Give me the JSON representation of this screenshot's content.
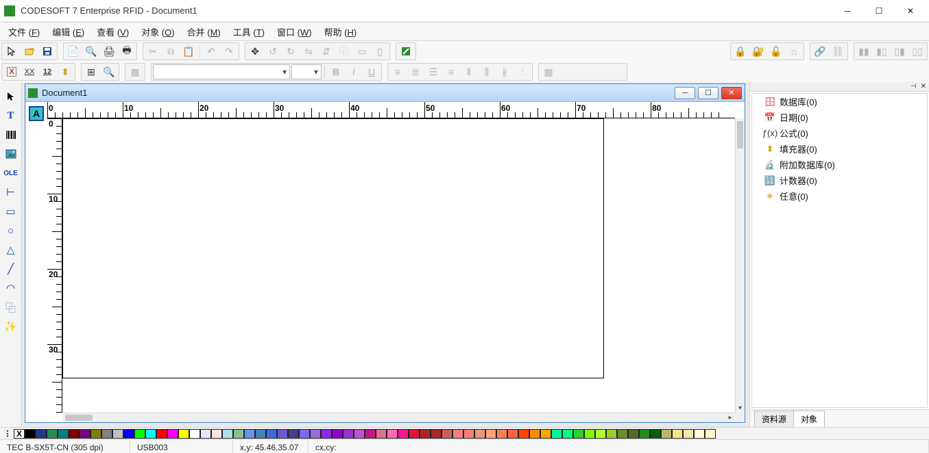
{
  "app": {
    "title": "CODESOFT 7 Enterprise RFID - Document1"
  },
  "menubar": [
    {
      "label": "文件",
      "accel": "F"
    },
    {
      "label": "编辑",
      "accel": "E"
    },
    {
      "label": "查看",
      "accel": "V"
    },
    {
      "label": "对象",
      "accel": "O"
    },
    {
      "label": "合并",
      "accel": "M"
    },
    {
      "label": "工具",
      "accel": "T"
    },
    {
      "label": "窗口",
      "accel": "W"
    },
    {
      "label": "帮助",
      "accel": "H"
    }
  ],
  "document": {
    "title": "Document1"
  },
  "ruler": {
    "h_labels": [
      "0",
      "10",
      "20",
      "30",
      "40",
      "50",
      "60",
      "70",
      "80"
    ],
    "v_labels": [
      "0",
      "10",
      "20",
      "30"
    ]
  },
  "datasources": [
    {
      "icon": "database-icon",
      "label": "数据库(0)",
      "color": "#c62828"
    },
    {
      "icon": "date-icon",
      "label": "日期(0)",
      "color": "#b71c1c"
    },
    {
      "icon": "formula-icon",
      "label": "公式(0)",
      "color": "#333"
    },
    {
      "icon": "fill-icon",
      "label": "填充器(0)",
      "color": "#d4a000"
    },
    {
      "icon": "ext-db-icon",
      "label": "附加数据库(0)",
      "color": "#111"
    },
    {
      "icon": "counter-icon",
      "label": "计数器(0)",
      "color": "#1e5aa8"
    },
    {
      "icon": "any-icon",
      "label": "任意(0)",
      "color": "#d48f00"
    }
  ],
  "panel_tabs": {
    "t1": "资料源",
    "t2": "对象"
  },
  "status": {
    "printer": "TEC B-SX5T-CN (305 dpi)",
    "port": "USB003",
    "coords": "x,y: 45.46,35.07",
    "cxcy": "cx,cy:"
  },
  "colors": [
    "#000000",
    "#1f3a93",
    "#2e8b57",
    "#008080",
    "#800000",
    "#800080",
    "#808000",
    "#808080",
    "#c0c0c0",
    "#0000ff",
    "#00ff00",
    "#00ffff",
    "#ff0000",
    "#ff00ff",
    "#ffff00",
    "#ffffff",
    "#e6e6fa",
    "#ffe4e1",
    "#b0e0e6",
    "#8fbc8f",
    "#6495ed",
    "#4682b4",
    "#4169e1",
    "#6a5acd",
    "#483d8b",
    "#7b68ee",
    "#9370db",
    "#8a2be2",
    "#9400d3",
    "#9932cc",
    "#ba55d3",
    "#c71585",
    "#db7093",
    "#ff69b4",
    "#ff1493",
    "#dc143c",
    "#b22222",
    "#a52a2a",
    "#cd5c5c",
    "#f08080",
    "#fa8072",
    "#e9967a",
    "#ffa07a",
    "#ff7f50",
    "#ff6347",
    "#ff4500",
    "#ff8c00",
    "#ffa500",
    "#00fa9a",
    "#00ff7f",
    "#32cd32",
    "#7cfc00",
    "#adff2f",
    "#9acd32",
    "#6b8e23",
    "#556b2f",
    "#228b22",
    "#006400",
    "#bdb76b",
    "#f0e68c",
    "#eee8aa",
    "#ffffe0",
    "#fffacd"
  ],
  "tool_icons": {
    "r1g1": [
      "cursor",
      "open",
      "save"
    ],
    "r1g2": [
      "page-setup",
      "print-preview",
      "print",
      "quick-print"
    ],
    "r1g3": [
      "cut",
      "copy",
      "paste",
      "undo",
      "redo"
    ],
    "r1g4": [
      "move",
      "rotate-left",
      "rotate-right",
      "flip-h",
      "flip-v",
      "clone",
      "align",
      "distribute"
    ],
    "r1g5": [
      "design-mode"
    ],
    "r1g6": [
      "lock",
      "lock-all",
      "unlock",
      "home"
    ],
    "r1g7": [
      "link",
      "unlink"
    ],
    "r1g8": [
      "barcode-a",
      "barcode-b",
      "barcode-c",
      "barcode-d"
    ],
    "r2g1": [
      "format-a",
      "format-b",
      "format-c",
      "format-d"
    ],
    "r2g2": [
      "mode-a",
      "zoom"
    ],
    "r2g3": [
      "grid"
    ],
    "r2g4": [
      "bold",
      "italic",
      "underline"
    ],
    "r2g5": [
      "align-1",
      "align-l",
      "align-c",
      "align-r",
      "align-2",
      "align-3",
      "align-4",
      "align-5"
    ],
    "left": [
      "pointer",
      "text",
      "barcode",
      "image",
      "ole",
      "anchor",
      "rect",
      "circle",
      "triangle",
      "line",
      "arc",
      "stack",
      "wand"
    ]
  }
}
